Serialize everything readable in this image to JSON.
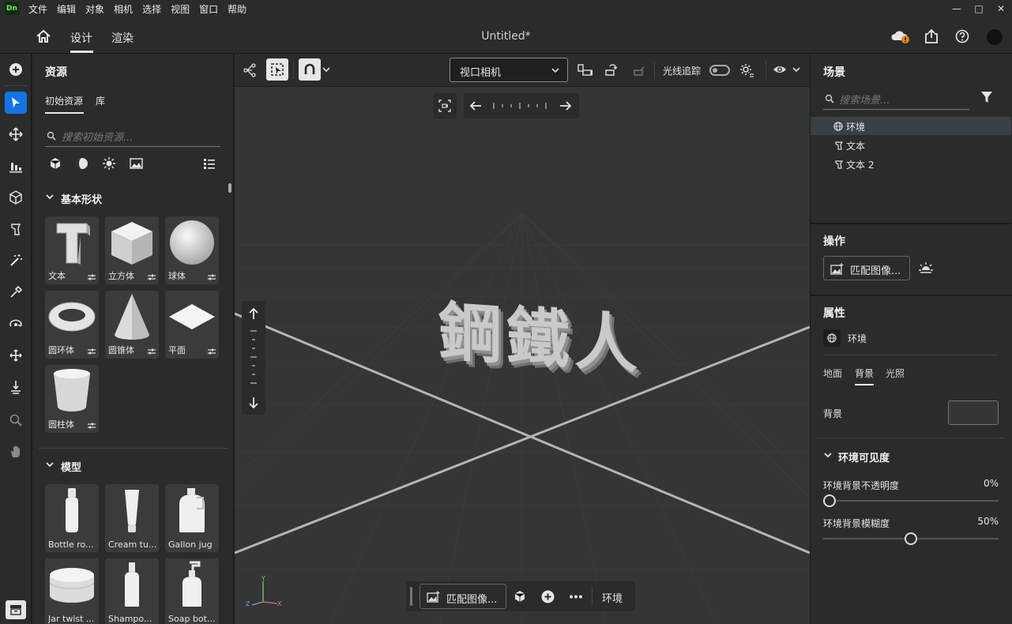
{
  "app": {
    "logo": "Dn",
    "title": "Untitled*"
  },
  "menu": [
    "文件",
    "编辑",
    "对象",
    "相机",
    "选择",
    "视图",
    "窗口",
    "帮助"
  ],
  "window_controls": {
    "minimize": "—",
    "maximize": "□",
    "close": "✕"
  },
  "top_tabs": {
    "design": "设计",
    "render": "渲染"
  },
  "assets": {
    "title": "资源",
    "tabs": [
      "初始资源",
      "库"
    ],
    "search_placeholder": "搜索初始资源...",
    "basic_shapes_header": "基本形状",
    "basic_shapes": [
      "文本",
      "立方体",
      "球体",
      "圆环体",
      "圆锥体",
      "平面",
      "圆柱体"
    ],
    "models_header": "模型",
    "models": [
      "Bottle ro...",
      "Cream tu...",
      "Gallon jug",
      "Jar twist ...",
      "Shampo...",
      "Soap bot..."
    ]
  },
  "viewport": {
    "camera_select": "视口相机",
    "raytrace_label": "光线追踪",
    "scene_text": "鋼鐵人",
    "bottom_match_image": "匹配图像...",
    "bottom_environment": "环境",
    "axis": {
      "x": "X",
      "y": "Y",
      "z": "Z"
    }
  },
  "scene": {
    "title": "场景",
    "search_placeholder": "搜索场景...",
    "items": [
      "环境",
      "文本",
      "文本 2"
    ]
  },
  "actions": {
    "title": "操作",
    "match_image": "匹配图像..."
  },
  "properties": {
    "title": "属性",
    "selected": "环境",
    "tabs": [
      "地面",
      "背景",
      "光照"
    ],
    "background_label": "背景",
    "env_visibility_header": "环境可见度",
    "opacity_label": "环境背景不透明度",
    "opacity_value": "0%",
    "blur_label": "环境背景模糊度",
    "blur_value": "50%",
    "opacity_level": 0.0,
    "blur_level": 0.5
  },
  "colors": {
    "accent": "#1473e6",
    "panel": "#2b2b2b",
    "viewport": "#353535",
    "notify": "#e68619"
  }
}
